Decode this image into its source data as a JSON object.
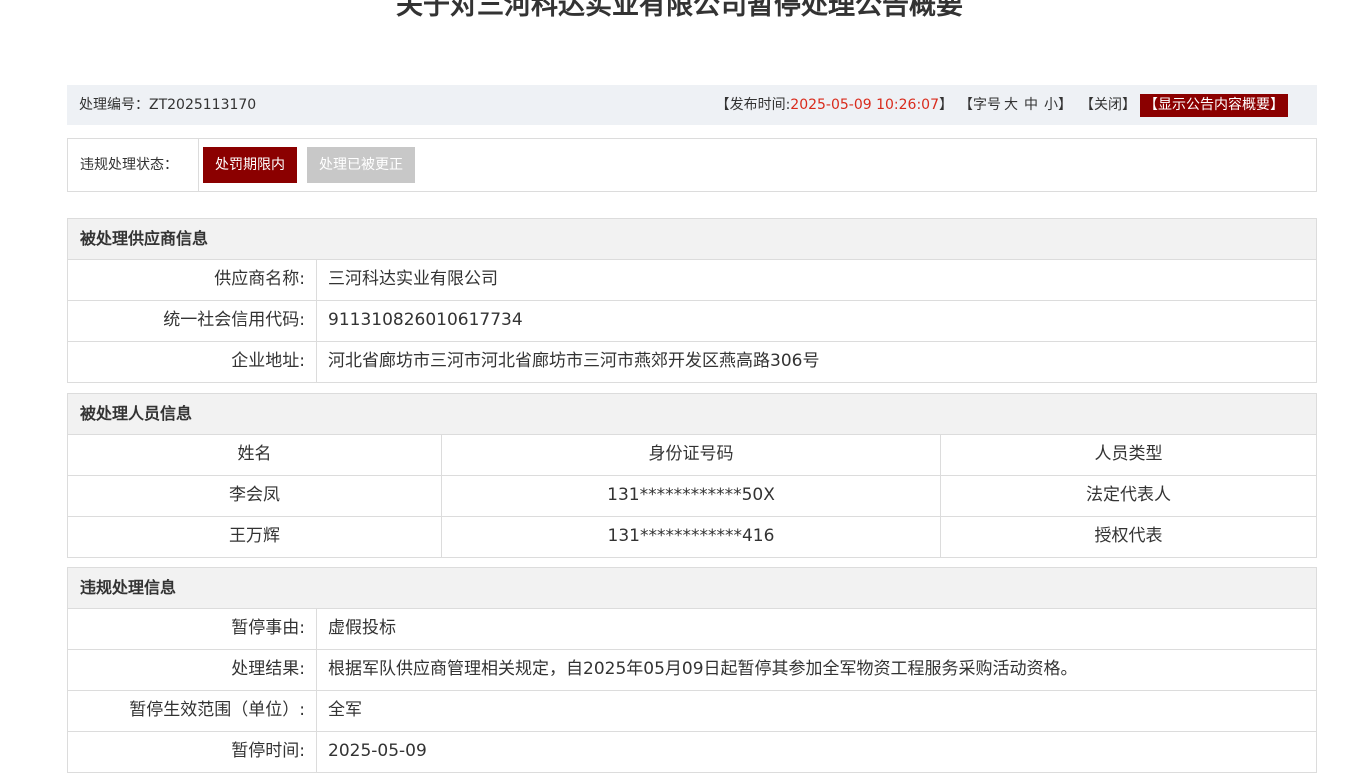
{
  "title": "关于对三河科达实业有限公司暂停处理公告概要",
  "infobar": {
    "code_label": "处理编号：",
    "code_value": "ZT2025113170",
    "publish_open": "【发布时间: ",
    "publish_time": "2025-05-09 10:26:07",
    "publish_close": "】",
    "font_open": "【字号",
    "font_large": "大",
    "font_medium": "中",
    "font_small": "小】",
    "close_label": "【关闭】",
    "show_summary": "【显示公告内容概要】"
  },
  "status": {
    "label": "违规处理状态：",
    "active": "处罚期限内",
    "inactive": "处理已被更正"
  },
  "supplier": {
    "header": "被处理供应商信息",
    "rows": [
      {
        "k": "供应商名称:",
        "v": "三河科达实业有限公司"
      },
      {
        "k": "统一社会信用代码:",
        "v": "911310826010617734"
      },
      {
        "k": "企业地址:",
        "v": "河北省廊坊市三河市河北省廊坊市三河市燕郊开发区燕高路306号"
      }
    ]
  },
  "persons": {
    "header": "被处理人员信息",
    "columns": [
      "姓名",
      "身份证号码",
      "人员类型"
    ],
    "rows": [
      [
        "李会凤",
        "131************50X",
        "法定代表人"
      ],
      [
        "王万辉",
        "131************416",
        "授权代表"
      ]
    ]
  },
  "violation": {
    "header": "违规处理信息",
    "rows": [
      {
        "k": "暂停事由:",
        "v": "虚假投标"
      },
      {
        "k": "处理结果:",
        "v": "根据军队供应商管理相关规定，自2025年05月09日起暂停其参加全军物资工程服务采购活动资格。"
      },
      {
        "k": "暂停生效范围（单位）:",
        "v": "全军"
      },
      {
        "k": "暂停时间:",
        "v": "2025-05-09"
      }
    ]
  },
  "colors": {
    "accent": "#8b0000",
    "highlight": "#d92b1c",
    "bar_bg": "#eef1f5"
  }
}
